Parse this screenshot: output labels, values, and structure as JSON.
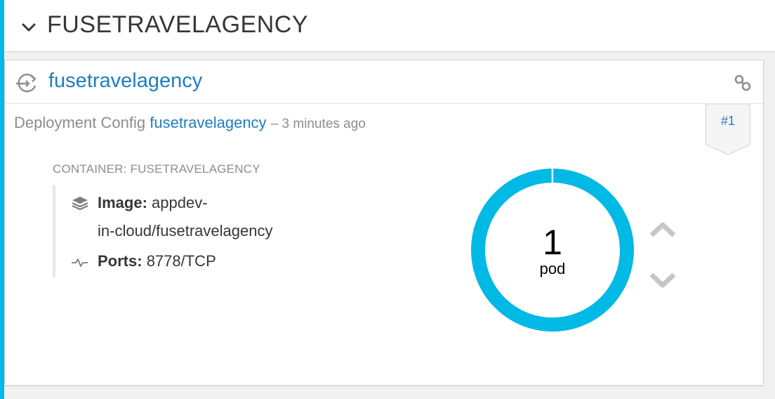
{
  "header": {
    "title": "FUSETRAVELAGENCY",
    "toggle_icon": "chevron-down-icon"
  },
  "card": {
    "dc_name": "fusetravelagency",
    "dc_icon": "deployment-config-icon",
    "link_icon": "link-icon",
    "deployment": {
      "prefix": "Deployment Config",
      "name": "fusetravelagency",
      "time": "– 3 minutes ago",
      "badge": "#1"
    },
    "container": {
      "label": "CONTAINER: FUSETRAVELAGENCY",
      "image_label": "Image:",
      "image_value_line1": "appdev-",
      "image_value_line2": "in-cloud/fusetravelagency",
      "ports_label": "Ports:",
      "ports_value": "8778/TCP",
      "image_icon": "layers-icon",
      "ports_icon": "pulse-icon"
    },
    "pods": {
      "count": "1",
      "label": "pod",
      "ring_color": "#00b9e4",
      "up_icon": "chevron-up-icon",
      "down_icon": "chevron-down-icon"
    }
  },
  "colors": {
    "accent": "#00b9e4",
    "link": "#1f7ebf",
    "muted": "#8b8d8f"
  }
}
